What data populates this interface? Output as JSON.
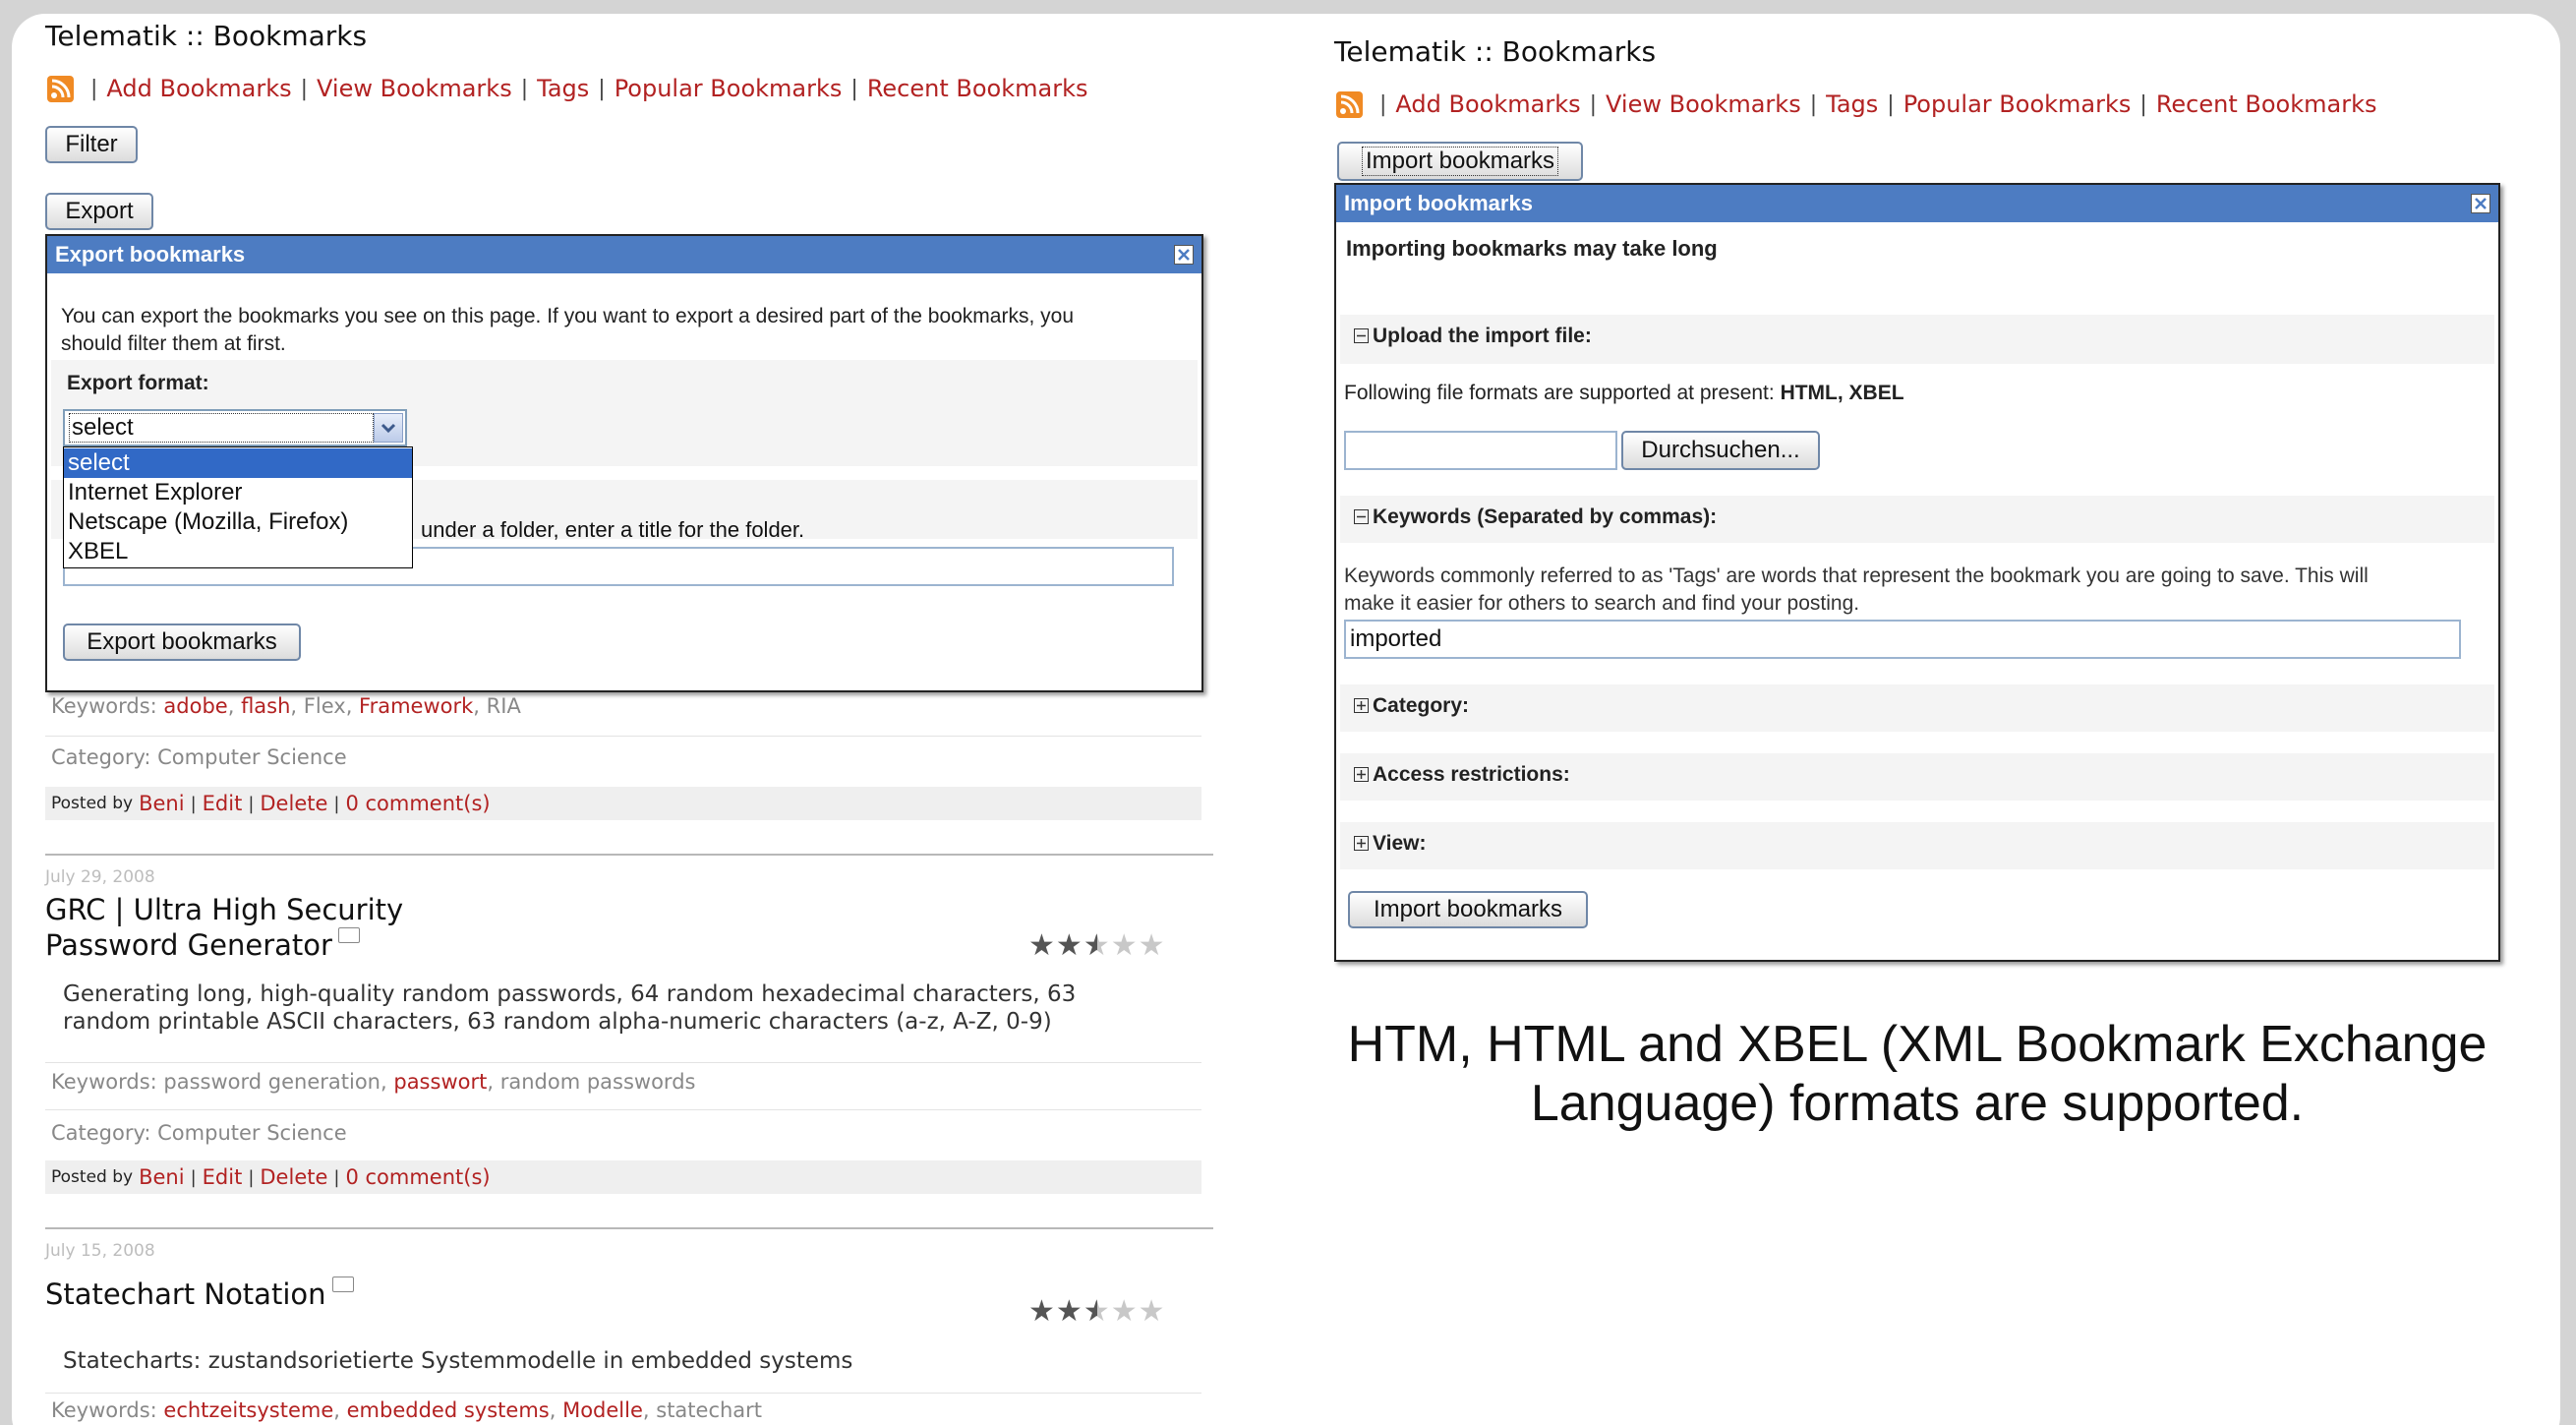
{
  "left": {
    "site_title": "Telematik :: Bookmarks",
    "nav": [
      "Add Bookmarks",
      "View Bookmarks",
      "Tags",
      "Popular Bookmarks",
      "Recent Bookmarks"
    ],
    "filter_button": "Filter",
    "export_button": "Export",
    "export_dialog": {
      "title": "Export bookmarks",
      "intro_line1": "You can export the bookmarks you see on this page. If you want to export a desired part of the bookmarks, you",
      "intro_line2": "should filter them at first.",
      "format_label": "Export format:",
      "format_selected": "select",
      "format_options": [
        "select",
        "Internet Explorer",
        "Netscape (Mozilla, Firefox)",
        "XBEL"
      ],
      "folder_hint": "under a folder, enter a title for the folder.",
      "folder_value": "",
      "submit": "Export bookmarks"
    },
    "first_item": {
      "keywords_label": "Keywords:",
      "keywords": [
        "adobe",
        "flash",
        "Flex",
        "Framework",
        "RIA"
      ],
      "category": "Category: Computer Science",
      "posted_by": "Posted by",
      "user": "Beni",
      "edit": "Edit",
      "delete": "Delete",
      "comments": "0 comment(s)"
    },
    "bookmarks": [
      {
        "date": "July 29, 2008",
        "title_line1": "GRC | Ultra High Security",
        "title_line2": "Password Generator",
        "rating": 2.5,
        "desc_line1": "Generating long, high-quality random passwords, 64 random hexadecimal characters, 63",
        "desc_line2": "random printable ASCII characters, 63 random alpha-numeric characters (a-z, A-Z, 0-9)",
        "keywords_label": "Keywords:",
        "keywords": [
          "password generation",
          "passwort",
          "random passwords"
        ],
        "category": "Category: Computer Science",
        "posted_by": "Posted by",
        "user": "Beni",
        "edit": "Edit",
        "delete": "Delete",
        "comments": "0 comment(s)"
      },
      {
        "date": "July 15, 2008",
        "title_line1": "Statechart Notation",
        "rating": 2.5,
        "desc_line1": "Statecharts: zustandsorietierte Systemmodelle in embedded systems",
        "keywords_label": "Keywords:",
        "keywords": [
          "echtzeitsysteme",
          "embedded systems",
          "Modelle",
          "statechart"
        ]
      }
    ]
  },
  "right": {
    "site_title": "Telematik :: Bookmarks",
    "nav": [
      "Add Bookmarks",
      "View Bookmarks",
      "Tags",
      "Popular Bookmarks",
      "Recent Bookmarks"
    ],
    "import_button": "Import bookmarks",
    "import_dialog": {
      "title": "Import bookmarks",
      "note": "Importing bookmarks may take long",
      "upload_label": "Upload the import file:",
      "formats_text": "Following file formats are supported at present:",
      "formats_value": "HTML, XBEL",
      "file_value": "",
      "browse": "Durchsuchen...",
      "keywords_label": "Keywords (Separated by commas):",
      "keywords_help_line1": "Keywords commonly referred to as 'Tags' are words that represent the bookmark you are going to save. This will",
      "keywords_help_line2": "make it easier for others to search and find your posting.",
      "keywords_value": "imported",
      "category_label": "Category:",
      "access_label": "Access restrictions:",
      "view_label": "View:",
      "submit": "Import bookmarks"
    },
    "caption_line1": "HTM, HTML and XBEL (XML Bookmark Exchange",
    "caption_line2": "Language) formats are supported."
  },
  "colors": {
    "link": "#b22222",
    "dialog_header": "#4d7cc2",
    "selected_option": "#3169c6",
    "frame_background": "#d4d4d4"
  },
  "icons": [
    "rss-feed-icon",
    "close-icon",
    "chevron-down-icon",
    "folder-icon",
    "star-icon",
    "collapse-icon",
    "expand-icon"
  ]
}
